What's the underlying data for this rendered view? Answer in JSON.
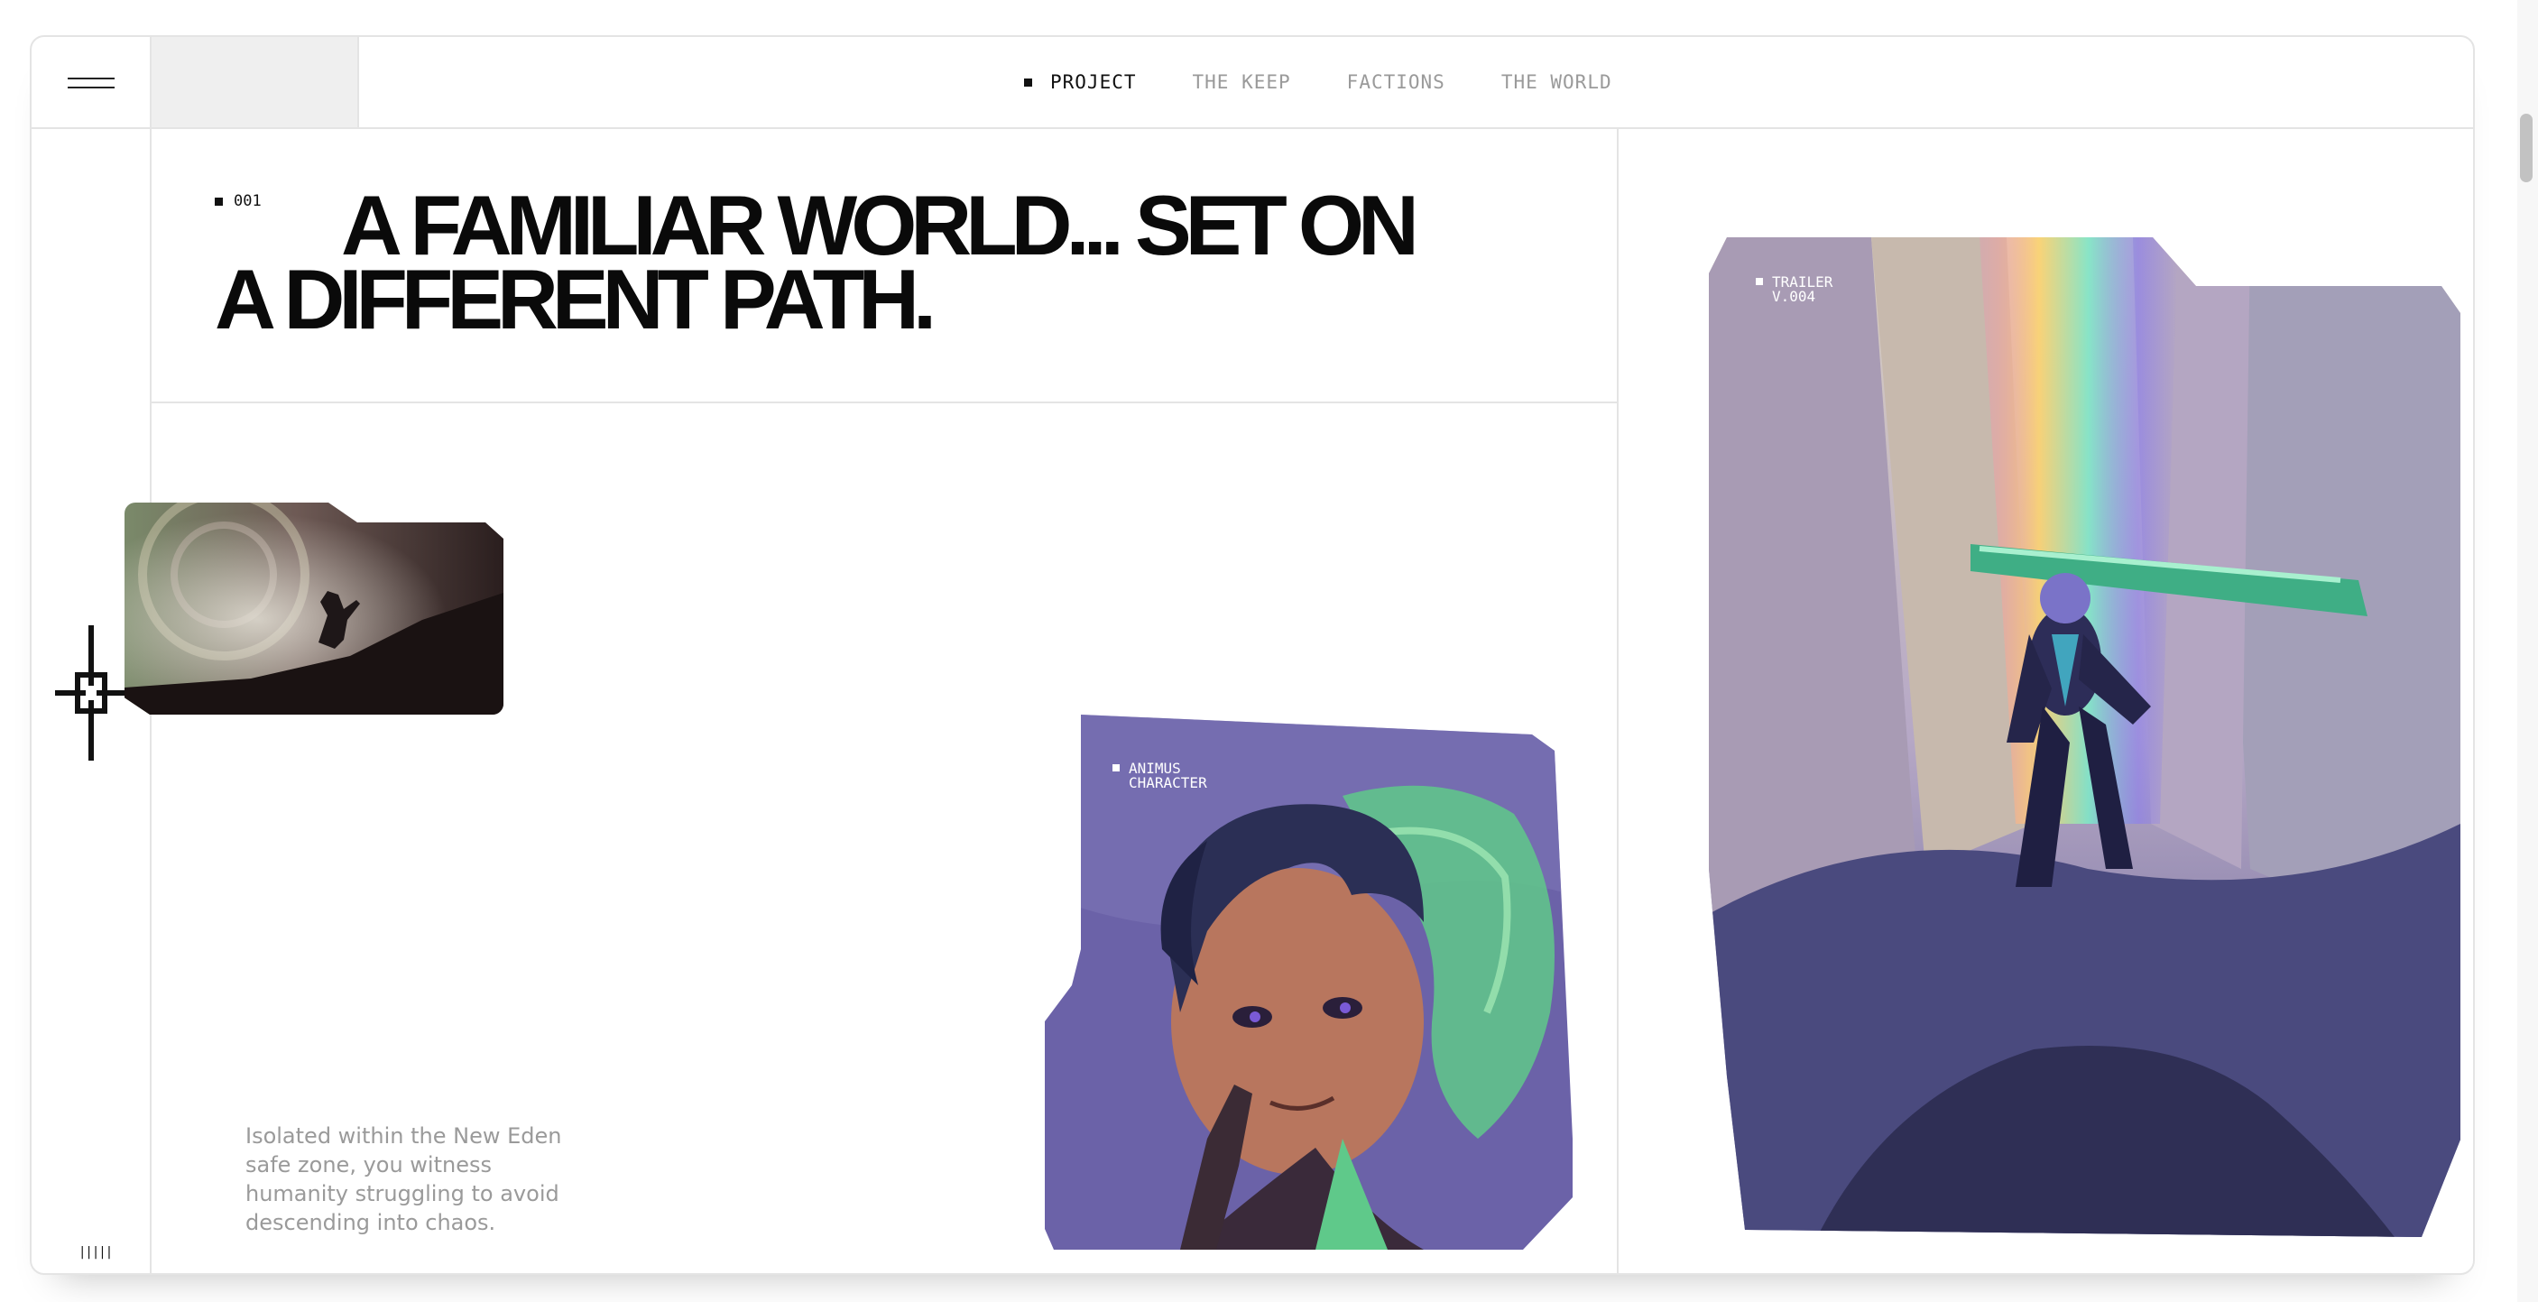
{
  "nav": {
    "items": [
      {
        "label": "PROJECT",
        "active": true
      },
      {
        "label": "THE KEEP",
        "active": false
      },
      {
        "label": "FACTIONS",
        "active": false
      },
      {
        "label": "THE WORLD",
        "active": false
      }
    ]
  },
  "hero": {
    "index": "001",
    "headline": "A FAMILIAR WORLD... SET ON A DIFFERENT PATH."
  },
  "cards": {
    "character_label": "ANIMUS CHARACTER",
    "trailer_label": "TRAILER V.004"
  },
  "description": "Isolated within the New Eden safe zone, you witness humanity struggling to avoid descending into chaos.",
  "footer_icon_text": "|||||",
  "colors": {
    "border": "#e4e4e4",
    "text_primary": "#0a0a0a",
    "text_muted": "#9a9a9a",
    "accent_purple": "#6b62a8",
    "accent_green": "#5fc98a"
  },
  "icons": [
    "menu-icon",
    "crosshair-icon",
    "dots-icon"
  ]
}
